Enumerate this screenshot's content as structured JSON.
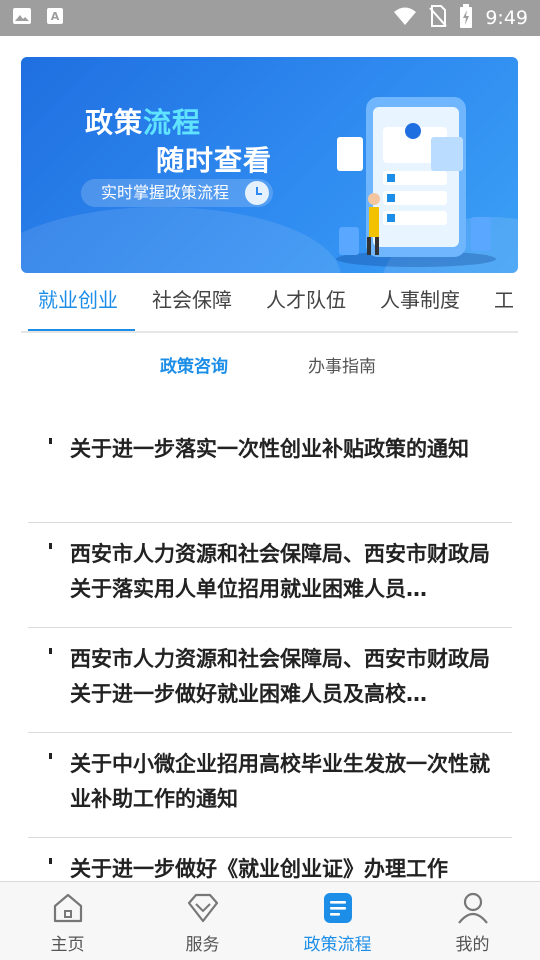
{
  "status_bar": {
    "time": "9:49",
    "icons": [
      "image-icon",
      "text-a-icon",
      "wifi-icon",
      "no-sim-icon",
      "battery-charging-icon"
    ]
  },
  "banner": {
    "title_part1": "政策",
    "title_part2": "流程",
    "title_line2": "随时查看",
    "pill_text": "实时掌握政策流程"
  },
  "tabs": [
    {
      "label": "就业创业",
      "active": true
    },
    {
      "label": "社会保障",
      "active": false
    },
    {
      "label": "人才队伍",
      "active": false
    },
    {
      "label": "人事制度",
      "active": false
    },
    {
      "label": "工",
      "active": false
    }
  ],
  "subtabs": {
    "active": "政策咨询",
    "inactive": "办事指南"
  },
  "news": [
    {
      "title": "关于进一步落实一次性创业补贴政策的通知"
    },
    {
      "title": "西安市人力资源和社会保障局、西安市财政局关于落实用人单位招用就业困难人员…"
    },
    {
      "title": "西安市人力资源和社会保障局、西安市财政局关于进一步做好就业困难人员及高校…"
    },
    {
      "title": "关于中小微企业招用高校毕业生发放一次性就业补助工作的通知"
    },
    {
      "title": "关于进一步做好《就业创业证》办理工作"
    }
  ],
  "bottom_nav": [
    {
      "label": "主页",
      "icon": "home-icon",
      "active": false
    },
    {
      "label": "服务",
      "icon": "diamond-icon",
      "active": false
    },
    {
      "label": "政策流程",
      "icon": "document-icon",
      "active": true
    },
    {
      "label": "我的",
      "icon": "person-icon",
      "active": false
    }
  ],
  "colors": {
    "accent": "#1d8ee8",
    "status_bar": "#9e9e9e",
    "banner_start": "#1f6fe0",
    "banner_end": "#3ba0f5"
  }
}
